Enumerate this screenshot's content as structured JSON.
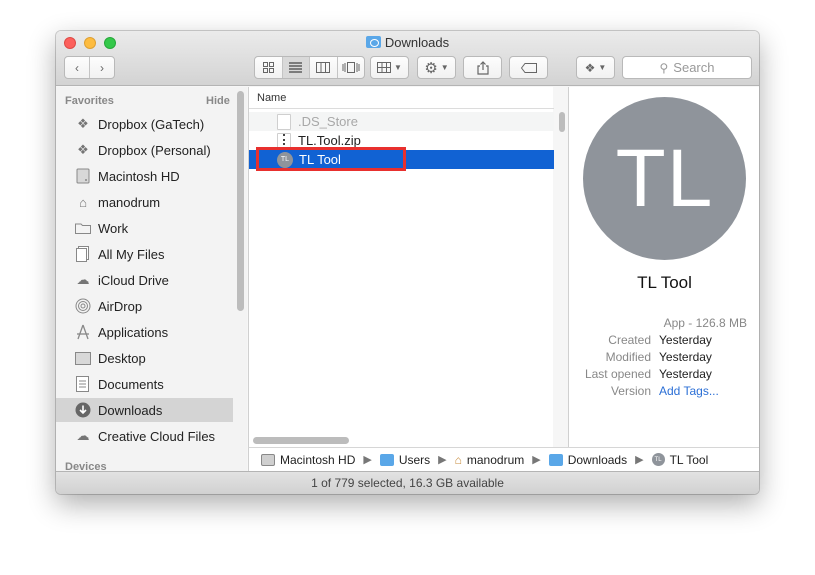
{
  "window": {
    "title": "Downloads"
  },
  "toolbar": {
    "search_placeholder": "Search"
  },
  "sidebar": {
    "favorites_heading": "Favorites",
    "hide_label": "Hide",
    "devices_heading": "Devices",
    "items": [
      {
        "label": "Dropbox (GaTech)",
        "icon": "dropbox-icon"
      },
      {
        "label": "Dropbox (Personal)",
        "icon": "dropbox-icon"
      },
      {
        "label": "Macintosh HD",
        "icon": "harddisk-icon"
      },
      {
        "label": "manodrum",
        "icon": "home-icon"
      },
      {
        "label": "Work",
        "icon": "folder-icon"
      },
      {
        "label": "All My Files",
        "icon": "all-files-icon"
      },
      {
        "label": "iCloud Drive",
        "icon": "cloud-icon"
      },
      {
        "label": "AirDrop",
        "icon": "airdrop-icon"
      },
      {
        "label": "Applications",
        "icon": "applications-icon"
      },
      {
        "label": "Desktop",
        "icon": "desktop-icon"
      },
      {
        "label": "Documents",
        "icon": "documents-icon"
      },
      {
        "label": "Downloads",
        "icon": "downloads-icon",
        "selected": true
      },
      {
        "label": "Creative Cloud Files",
        "icon": "creative-cloud-icon"
      }
    ]
  },
  "filelist": {
    "column_name": "Name",
    "files": [
      {
        "name": ".DS_Store",
        "kind": "hidden"
      },
      {
        "name": "TL.Tool.zip",
        "kind": "zip"
      },
      {
        "name": "TL Tool",
        "kind": "app",
        "icon_text": "TL",
        "selected": true
      }
    ]
  },
  "preview": {
    "icon_text": "TL",
    "name": "TL Tool",
    "kind_size": "App - 126.8 MB",
    "created_label": "Created",
    "created_value": "Yesterday",
    "modified_label": "Modified",
    "modified_value": "Yesterday",
    "opened_label": "Last opened",
    "opened_value": "Yesterday",
    "version_label": "Version",
    "tags_link": "Add Tags..."
  },
  "pathbar": [
    "Macintosh HD",
    "Users",
    "manodrum",
    "Downloads",
    "TL Tool"
  ],
  "status": "1 of 779 selected, 16.3 GB available",
  "colors": {
    "selection": "#1162d3",
    "highlight_box": "#e8302e",
    "app_icon": "#8f949b"
  }
}
